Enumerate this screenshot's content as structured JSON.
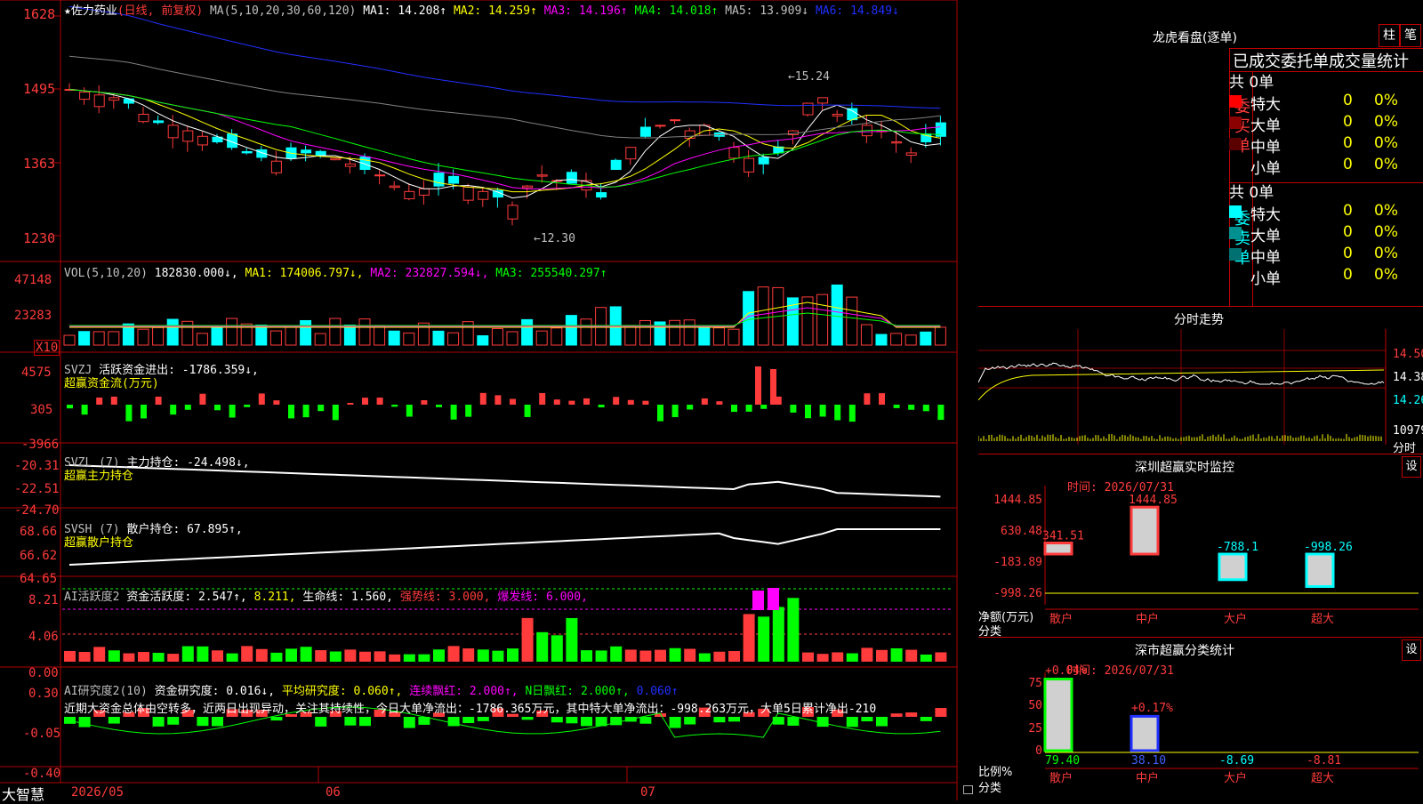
{
  "colors": {
    "up": "#ff3b3b",
    "down": "#00ffff",
    "frame": "#c00000",
    "ma1": "#ffffff",
    "ma2": "#ffff00",
    "ma3": "#ff00ff",
    "ma4": "#00ff00",
    "ma5": "#808080",
    "ma6": "#2030ff",
    "text": "#c0c0c0",
    "yellow": "#ffff00"
  },
  "header": {
    "star": "★",
    "name": "佐力药业",
    "period": "(日线, 前复权)",
    "ma_params": "MA(5,10,20,30,60,120)",
    "ma1": "MA1: 14.208↑",
    "ma2": "MA2: 14.259↑",
    "ma3": "MA3: 14.196↑",
    "ma4": "MA4: 14.018↑",
    "ma5": "MA5: 13.909↓",
    "ma6": "MA6: 14.849↓",
    "high_mark": "←15.24",
    "low_mark": "←12.30"
  },
  "price_axis": [
    "1628",
    "1495",
    "1363",
    "1230"
  ],
  "vol": {
    "title": "VOL(5,10,20)",
    "value": "182830.000↓,",
    "ma1": "MA1: 174006.797↓,",
    "ma2": "MA2: 232827.594↓,",
    "ma3": "MA3: 255540.297↑",
    "axis": [
      "47148",
      "23283"
    ],
    "unit": "X10"
  },
  "svzj": {
    "name": "SVZJ",
    "title": "活跃资金进出: -1786.359↓,",
    "sub": "超赢资金流(万元)",
    "axis": [
      "4575",
      "305",
      "-3966"
    ]
  },
  "svzl": {
    "name": "SVZL (7)",
    "title": "主力持仓: -24.498↓,",
    "sub": "超赢主力持仓",
    "axis": [
      "-20.31",
      "-22.51",
      "-24.70"
    ]
  },
  "svsh": {
    "name": "SVSH (7)",
    "title": "散户持仓: 67.895↑,",
    "sub": "超赢散户持仓",
    "axis": [
      "68.66",
      "66.62",
      "64.65"
    ]
  },
  "ai1": {
    "name": "AI活跃度2",
    "l1": "资金活跃度: 2.547↑,",
    "l2": "8.211,",
    "l3": "生命线: 1.560,",
    "l4": "强势线: 3.000,",
    "l5": "爆发线: 6.000,",
    "axis": [
      "8.21",
      "4.06",
      "0.00"
    ]
  },
  "ai2": {
    "name": "AI研究度2(10)",
    "l1": "资金研究度: 0.016↓,",
    "l2": "平均研究度: 0.060↑,",
    "l3": "连续飘红: 2.000↑,",
    "l4": "N日飘红: 2.000↑,",
    "l5": "0.060↑",
    "desc": "近期大资金总体由空转多，近两日出现异动，关注其持续性，今日大单净流出：-1786.365万元，其中特大单净流出：-998.263万元，大单5日累计净出-210",
    "axis": [
      "0.30",
      "-0.05",
      "-0.40"
    ]
  },
  "bottom": {
    "brand": "大智慧",
    "dates": [
      "2026/05",
      "06",
      "07"
    ]
  },
  "lhb": {
    "title": "龙虎看盘(逐单)",
    "btn1": "柱",
    "btn2": "笔",
    "header": "已成交委托单成交量统计",
    "buy_label": "委买单",
    "sell_label": "委卖单",
    "buy": {
      "total": "共 0单",
      "rows": [
        {
          "name": "特大",
          "v": "0",
          "p": "0%",
          "c": "#ff0000"
        },
        {
          "name": "大单",
          "v": "0",
          "p": "0%",
          "c": "#8b0000"
        },
        {
          "name": "中单",
          "v": "0",
          "p": "0%",
          "c": "#5a0000"
        },
        {
          "name": "小单",
          "v": "0",
          "p": "0%",
          "c": ""
        }
      ]
    },
    "sell": {
      "total": "共 0单",
      "rows": [
        {
          "name": "特大",
          "v": "0",
          "p": "0%",
          "c": "#00ffff"
        },
        {
          "name": "大单",
          "v": "0",
          "p": "0%",
          "c": "#009090"
        },
        {
          "name": "中单",
          "v": "0",
          "p": "0%",
          "c": "#007070"
        },
        {
          "name": "小单",
          "v": "0",
          "p": "0%",
          "c": ""
        }
      ]
    }
  },
  "intraday": {
    "title": "分时走势",
    "axis": [
      "14.50",
      "14.38",
      "14.26"
    ],
    "vol_val": "10979",
    "vol_lbl": "分时"
  },
  "monitor": {
    "title": "深圳超赢实时监控",
    "btn": "设",
    "time": "时间: 2026/07/31",
    "axis": [
      "1444.85",
      "630.48",
      "-183.89",
      "-998.26"
    ],
    "ylabel": "净额(万元)",
    "xlabel": "分类",
    "cats": [
      "散户",
      "中户",
      "大户",
      "超大"
    ],
    "labels": [
      "341.51",
      "1444.85",
      "-788.1",
      "-998.26"
    ]
  },
  "classify": {
    "title": "深市超赢分类统计",
    "btn": "设",
    "time": "时间: 2026/07/31",
    "axis": [
      "75",
      "50",
      "25",
      "0"
    ],
    "ylabel": "比例%",
    "xlabel": "分类",
    "cats": [
      "散户",
      "中户",
      "大户",
      "超大"
    ],
    "top_labels": [
      "+0.04%",
      "+0.17%"
    ],
    "bottom_labels": [
      "79.40",
      "38.10",
      "-8.69",
      "-8.81"
    ]
  }
}
